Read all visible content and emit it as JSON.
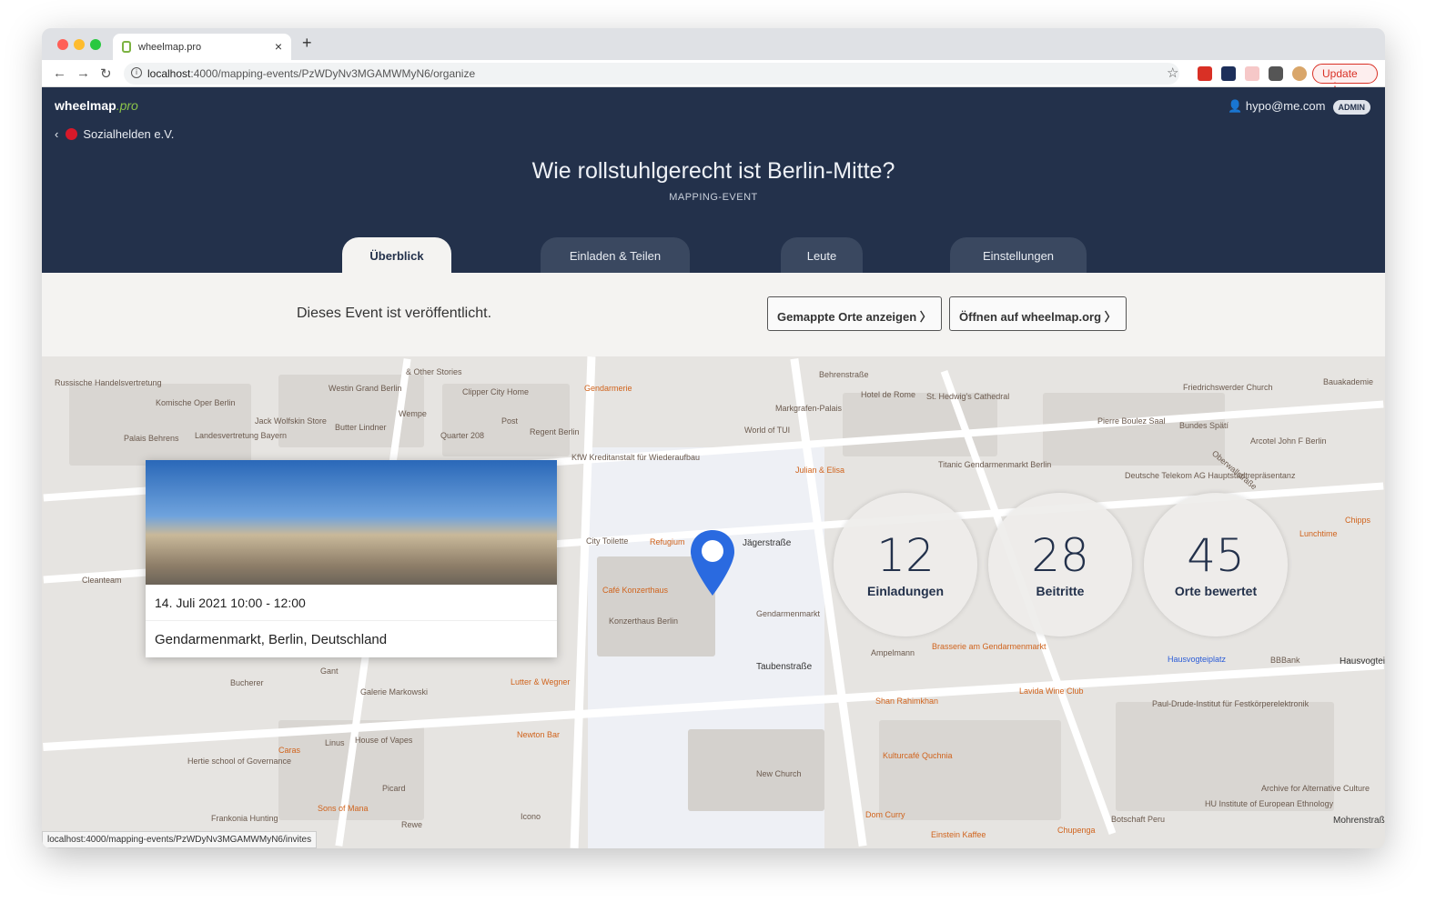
{
  "browser": {
    "tab_title": "wheelmap.pro",
    "url_host": "localhost",
    "url_path": ":4000/mapping-events/PzWDyNv3MGAMWMyN6/organize",
    "update_label": "Update",
    "status_url": "localhost:4000/mapping-events/PzWDyNv3MGAMWMyN6/invites"
  },
  "header": {
    "logo_main": "wheelmap",
    "logo_suffix": ".pro",
    "organization": "Sozialhelden e.V.",
    "user_email": "hypo@me.com",
    "role_badge": "ADMIN",
    "event_title": "Wie rollstuhlgerecht ist Berlin-Mitte?",
    "event_type": "MAPPING-EVENT"
  },
  "tabs": [
    {
      "label": "Überblick"
    },
    {
      "label": "Einladen & Teilen"
    },
    {
      "label": "Leute"
    },
    {
      "label": "Einstellungen"
    }
  ],
  "banner": {
    "status": "Dieses Event ist veröffentlicht.",
    "show_places": "Gemappte Orte anzeigen",
    "open_wheelmap": "Öffnen auf wheelmap.org"
  },
  "event_card": {
    "datetime": "14. Juli 2021 10:00 - 12:00",
    "location": "Gendarmenmarkt, Berlin, Deutschland"
  },
  "stats": [
    {
      "value": "12",
      "label": "Einladungen"
    },
    {
      "value": "28",
      "label": "Beitritte"
    },
    {
      "value": "45",
      "label": "Orte bewertet"
    }
  ],
  "map": {
    "labels": [
      "Russische Handelsvertretung",
      "Komische Oper Berlin",
      "Westin Grand Berlin",
      "& Other Stories",
      "Clipper City Home",
      "Gendarmerie",
      "Behrenstraße",
      "Hotel de Rome",
      "St. Hedwig's Cathedral",
      "Friedrichswerder Church",
      "Bauakademie",
      "Jack Wolfskin Store",
      "Butter Lindner",
      "Wempe",
      "Post",
      "Regent Berlin",
      "Quarter 208",
      "Markgrafen-Palais",
      "World of TUI",
      "Pierre Boulez Saal",
      "Bundes Spätí",
      "Arcotel John F Berlin",
      "Palais Behrens",
      "Landesvertretung Bayern",
      "KfW Kreditanstalt für Wiederaufbau",
      "Julian & Elisa",
      "Titanic Gendarmenmarkt Berlin",
      "Deutsche Telekom AG Hauptstadtrepräsentanz",
      "Oberwallstraße",
      "City Toilette",
      "Refugium",
      "Jägerstraße",
      "Café Konzerthaus",
      "Konzerthaus Berlin",
      "Gendarmenmarkt",
      "Taubenstraße",
      "Ampelmann",
      "Brasserie am Gendarmenmarkt",
      "Hausvogteiplatz",
      "BBBank",
      "Lunchtime",
      "Chipps",
      "Cleanteam",
      "Bucherer",
      "Gant",
      "Galerie Markowski",
      "Lutter & Wegner",
      "Shan Rahimkhan",
      "Lavida Wine Club",
      "Paul-Drude-Institut für Festkörperelektronik",
      "Newton Bar",
      "Caras",
      "Linus",
      "House of Vapes",
      "Hertie school of Governance",
      "Picard",
      "Sons of Mana",
      "Frankonia Hunting",
      "Rewe",
      "Icono",
      "New Church",
      "Kulturcafé Quchnia",
      "Dom Curry",
      "Einstein Kaffee",
      "Chupenga",
      "Botschaft Peru",
      "HU Institute of European Ethnology",
      "Archive for Alternative Culture",
      "Mohrenstraße",
      "Hausvogteiplatz"
    ]
  }
}
